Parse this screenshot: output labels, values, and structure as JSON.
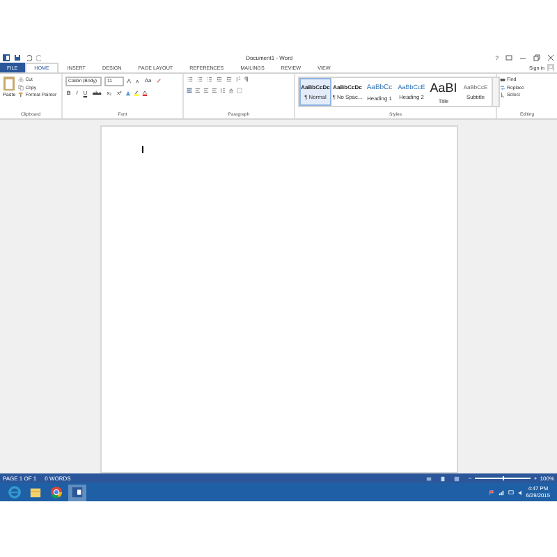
{
  "window": {
    "title": "Document1 - Word",
    "help": "?",
    "sign_in": "Sign in"
  },
  "tabs": [
    {
      "label": "FILE",
      "kind": "file",
      "selected": false
    },
    {
      "label": "HOME",
      "kind": "tab",
      "selected": true
    },
    {
      "label": "INSERT",
      "kind": "tab",
      "selected": false
    },
    {
      "label": "DESIGN",
      "kind": "tab",
      "selected": false
    },
    {
      "label": "PAGE LAYOUT",
      "kind": "tab",
      "selected": false
    },
    {
      "label": "REFERENCES",
      "kind": "tab",
      "selected": false
    },
    {
      "label": "MAILINGS",
      "kind": "tab",
      "selected": false
    },
    {
      "label": "REVIEW",
      "kind": "tab",
      "selected": false
    },
    {
      "label": "VIEW",
      "kind": "tab",
      "selected": false
    }
  ],
  "clipboard": {
    "paste": "Paste",
    "cut": "Cut",
    "copy": "Copy",
    "format_painter": "Format Painter",
    "label": "Clipboard"
  },
  "font": {
    "family": "Calibri (Body)",
    "size": "11",
    "change_case": "Aa",
    "buttons": [
      "B",
      "I",
      "U",
      "abc",
      "x₂",
      "x²"
    ],
    "label": "Font"
  },
  "paragraph": {
    "label": "Paragraph"
  },
  "styles": {
    "label": "Styles",
    "items": [
      {
        "preview": "AaBbCcDc",
        "name": "¶ Normal",
        "selected": true,
        "kind": "body"
      },
      {
        "preview": "AaBbCcDc",
        "name": "¶ No Spac...",
        "selected": false,
        "kind": "body"
      },
      {
        "preview": "AaBbCc",
        "name": "Heading 1",
        "selected": false,
        "kind": "heading1"
      },
      {
        "preview": "AaBbCcE",
        "name": "Heading 2",
        "selected": false,
        "kind": "heading2"
      },
      {
        "preview": "AaBI",
        "name": "Title",
        "selected": false,
        "kind": "title"
      },
      {
        "preview": "AaBbCcE",
        "name": "Subtitle",
        "selected": false,
        "kind": "subtitle"
      }
    ]
  },
  "editing": {
    "label": "Editing",
    "items": [
      "Find",
      "Replace",
      "Select"
    ]
  },
  "status_bar": {
    "page": "PAGE 1 OF 1",
    "words": "0 WORDS",
    "zoom": "100%",
    "zoom_level": {
      "level": 0.5
    }
  },
  "taskbar": {
    "time": "4:47 PM",
    "date": "6/29/2015"
  }
}
